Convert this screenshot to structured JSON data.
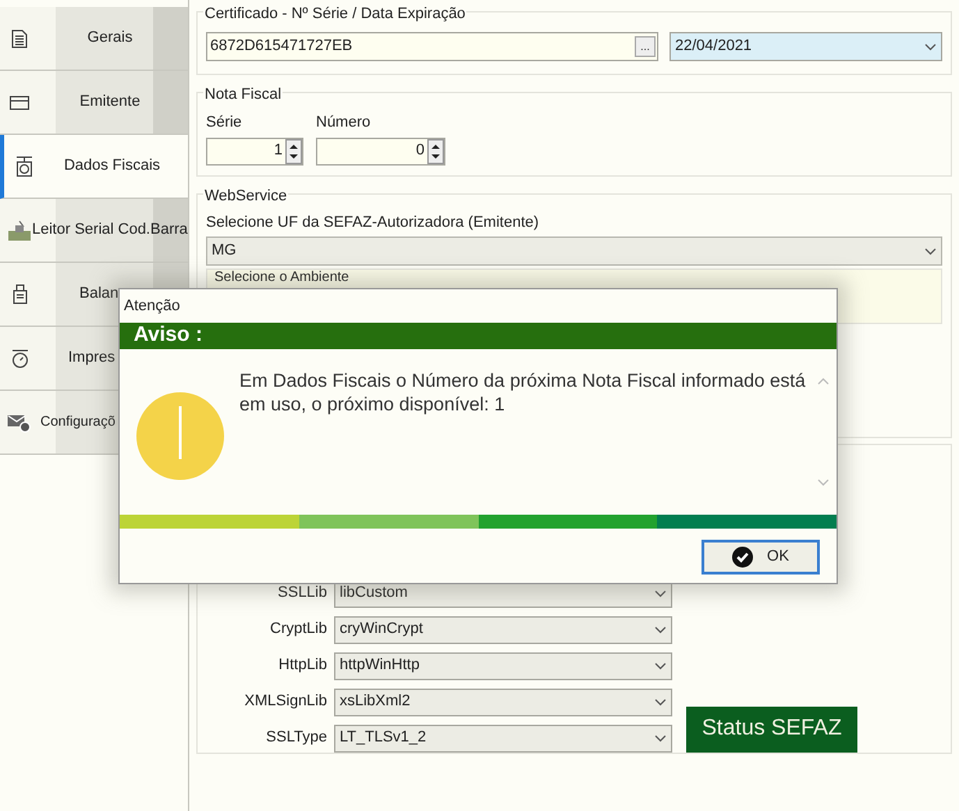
{
  "sidebar": {
    "tabs": [
      {
        "label": "Gerais",
        "selected": false
      },
      {
        "label": "Emitente",
        "selected": false
      },
      {
        "label": "Dados Fiscais",
        "selected": true
      },
      {
        "label": "Leitor Serial Cod.Barra",
        "selected": false
      },
      {
        "label": "Balan",
        "selected": false
      },
      {
        "label": "Impres",
        "selected": false
      },
      {
        "label": "Configuraçõ",
        "selected": false
      }
    ]
  },
  "certificado": {
    "legend": "Certificado - Nº Série / Data Expiração",
    "serial": "6872D615471727EB",
    "browse": "...",
    "expiration": "22/04/2021"
  },
  "nota_fiscal": {
    "legend": "Nota Fiscal",
    "serie_label": "Série",
    "serie": "1",
    "numero_label": "Número",
    "numero": "0"
  },
  "webservice": {
    "legend": "WebService",
    "uf_label": "Selecione UF da SEFAZ-Autorizadora (Emitente)",
    "uf": "MG",
    "ambiente_label": "Selecione o Ambiente"
  },
  "libs": [
    {
      "label": "SSLLib",
      "value": "libCustom"
    },
    {
      "label": "CryptLib",
      "value": "cryWinCrypt"
    },
    {
      "label": "HttpLib",
      "value": "httpWinHttp"
    },
    {
      "label": "XMLSignLib",
      "value": "xsLibXml2"
    },
    {
      "label": "SSLType",
      "value": "LT_TLSv1_2"
    }
  ],
  "status_button": "Status SEFAZ",
  "dialog": {
    "title": "Atenção",
    "header": "Aviso :",
    "message": "Em Dados Fiscais o Número da próxima Nota Fiscal informado está em uso, o próximo disponível: 1",
    "ok": "OK"
  }
}
